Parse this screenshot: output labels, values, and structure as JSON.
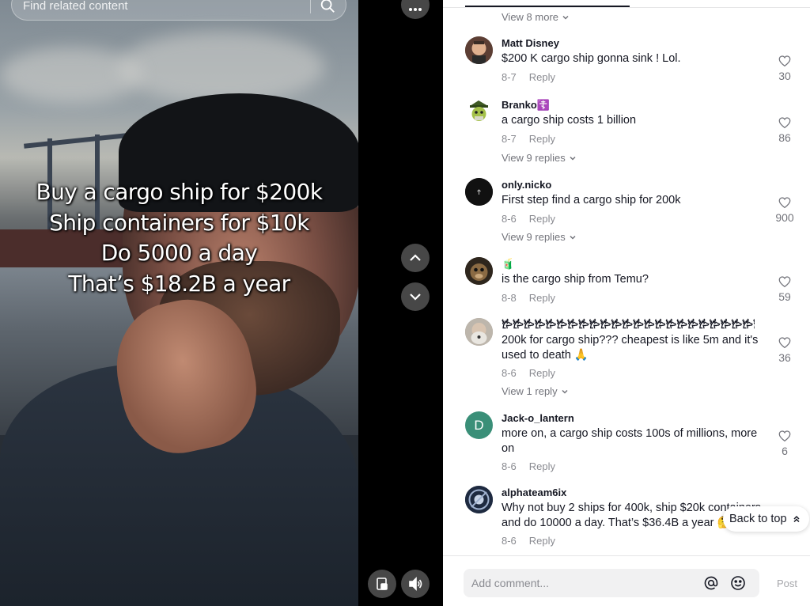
{
  "video": {
    "search_placeholder": "Find related content",
    "overlay_lines": [
      "Buy a cargo ship for $200k",
      "Ship containers for $10k",
      "Do 5000 a day",
      "That’s $18.2B a year"
    ]
  },
  "comments_panel": {
    "view_more_top": "View 8 more",
    "comments": [
      {
        "username": "Matt Disney",
        "text": "$200 K cargo ship gonna sink ! Lol.",
        "date": "8-7",
        "reply_label": "Reply",
        "likes": "30",
        "avatar_color": "#7a5a4a"
      },
      {
        "username": "Branko☦️",
        "text": "a cargo ship costs 1 billion",
        "date": "8-7",
        "reply_label": "Reply",
        "likes": "86",
        "view_replies": "View 9 replies",
        "avatar_color": "#6b8a3a"
      },
      {
        "username": "only.nicko",
        "text": "First step find a cargo ship for 200k",
        "date": "8-6",
        "reply_label": "Reply",
        "likes": "900",
        "view_replies": "View 9 replies",
        "avatar_color": "#111111"
      },
      {
        "username": "🧃",
        "text": "is the cargo ship from Temu?",
        "date": "8-8",
        "reply_label": "Reply",
        "likes": "59",
        "avatar_color": "#3c3024"
      },
      {
        "username": "𐂂𐂂𐂂𐂂𐂂𐂂𐂂𐂂𐂂𐂂𐂂𐂂𐂂𐂂𐂂𐂂𐂂𐂂𐂂𐂂𐂂𐂂𐂂𐂂𐂂𐂂𐂂𐂂𐂂𐂂𐂂𐂂𐂂𐂂𐂂𐂂𐂂𐂂𐂂𐂂𐂂",
        "text": "200k for cargo ship??? cheapest is like 5m and it's used to death 🙏",
        "date": "8-6",
        "reply_label": "Reply",
        "likes": "36",
        "view_replies": "View 1 reply",
        "avatar_color": "#9a948c"
      },
      {
        "username": "Jack-o_lantern",
        "text": "more on, a cargo ship costs 100s of millions, more on",
        "date": "8-6",
        "reply_label": "Reply",
        "likes": "6",
        "avatar_letter": "D",
        "avatar_color": "#3a8f78"
      },
      {
        "username": "alphateam6ix",
        "text": "Why not buy 2 ships for 400k, ship $20k containers and do 10000 a day. That’s $36.4B a year 🤔",
        "date": "8-6",
        "reply_label": "Reply",
        "likes": "",
        "avatar_color": "#2b3a55"
      }
    ],
    "back_to_top": "Back to top",
    "comment_placeholder": "Add comment...",
    "post_label": "Post"
  }
}
